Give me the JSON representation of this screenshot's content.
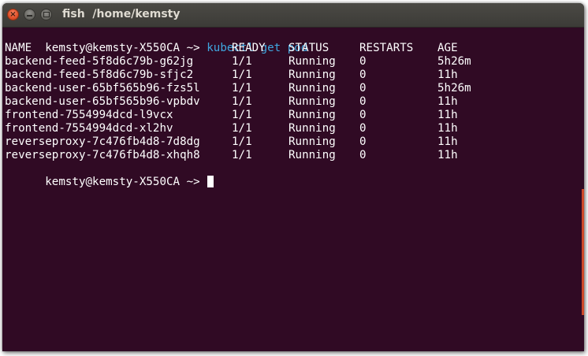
{
  "window": {
    "title": "fish  /home/kemsty",
    "close_glyph": "×",
    "colors": {
      "terminal_bg": "#300a24",
      "titlebar_bg": "#3c3b37",
      "close_button": "#e0502a",
      "command_text": "#3fa7e0",
      "text": "#ffffff"
    }
  },
  "terminal": {
    "prompt": "kemsty@kemsty-X550CA ~> ",
    "command": "kubectl get pod",
    "headers": {
      "name": "NAME",
      "ready": "READY",
      "status": "STATUS",
      "restarts": "RESTARTS",
      "age": "AGE"
    },
    "rows": [
      {
        "name": "backend-feed-5f8d6c79b-g62jg",
        "ready": "1/1",
        "status": "Running",
        "restarts": "0",
        "age": "5h26m"
      },
      {
        "name": "backend-feed-5f8d6c79b-sfjc2",
        "ready": "1/1",
        "status": "Running",
        "restarts": "0",
        "age": "11h"
      },
      {
        "name": "backend-user-65bf565b96-fzs5l",
        "ready": "1/1",
        "status": "Running",
        "restarts": "0",
        "age": "5h26m"
      },
      {
        "name": "backend-user-65bf565b96-vpbdv",
        "ready": "1/1",
        "status": "Running",
        "restarts": "0",
        "age": "11h"
      },
      {
        "name": "frontend-7554994dcd-l9vcx",
        "ready": "1/1",
        "status": "Running",
        "restarts": "0",
        "age": "11h"
      },
      {
        "name": "frontend-7554994dcd-xl2hv",
        "ready": "1/1",
        "status": "Running",
        "restarts": "0",
        "age": "11h"
      },
      {
        "name": "reverseproxy-7c476fb4d8-7d8dg",
        "ready": "1/1",
        "status": "Running",
        "restarts": "0",
        "age": "11h"
      },
      {
        "name": "reverseproxy-7c476fb4d8-xhqh8",
        "ready": "1/1",
        "status": "Running",
        "restarts": "0",
        "age": "11h"
      }
    ],
    "final_prompt": "kemsty@kemsty-X550CA ~> "
  }
}
